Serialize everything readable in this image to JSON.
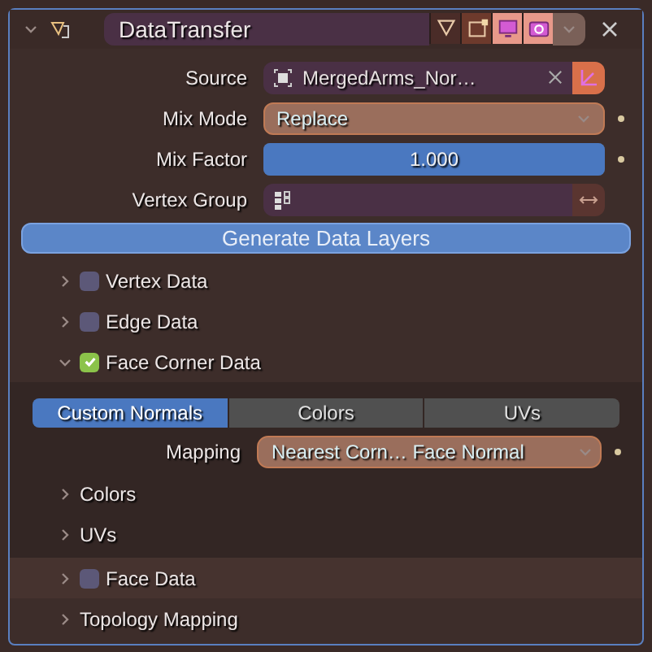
{
  "header": {
    "name": "DataTransfer",
    "expanded": true,
    "toggles": [
      {
        "kind": "editmode",
        "on": false
      },
      {
        "kind": "cage",
        "on": true
      },
      {
        "kind": "viewport",
        "on": true
      },
      {
        "kind": "render",
        "on": true
      }
    ]
  },
  "properties": [
    {
      "kind": "object",
      "label": "Source",
      "value": "MergedArms_Nor…"
    },
    {
      "kind": "dropdown",
      "label": "Mix Mode",
      "value": "Replace"
    },
    {
      "kind": "slider",
      "label": "Mix Factor",
      "value": "1.000",
      "level": 1
    },
    {
      "kind": "vertex_group",
      "label": "Vertex Group"
    }
  ],
  "generate_button": "Generate Data Layers",
  "sections": [
    {
      "kind": "checkbox",
      "label": "Vertex Data",
      "checked": false,
      "expanded": false
    },
    {
      "kind": "checkbox",
      "label": "Edge Data",
      "checked": false,
      "expanded": false
    },
    {
      "kind": "checkbox",
      "label": "Face Corner Data",
      "checked": true,
      "expanded": true,
      "tabs": [
        {
          "label": "Custom Normals",
          "selected": true
        },
        {
          "label": "Colors",
          "selected": false
        },
        {
          "label": "UVs",
          "selected": false
        }
      ],
      "mapping": {
        "label": "Mapping",
        "value": "Nearest Corn… Face Normal"
      },
      "subsections": [
        {
          "label": "Colors",
          "expanded": false
        },
        {
          "label": "UVs",
          "expanded": false
        }
      ]
    },
    {
      "kind": "checkbox",
      "label": "Face Data",
      "checked": false,
      "expanded": false
    },
    {
      "kind": "plain",
      "label": "Topology Mapping",
      "expanded": false
    }
  ]
}
